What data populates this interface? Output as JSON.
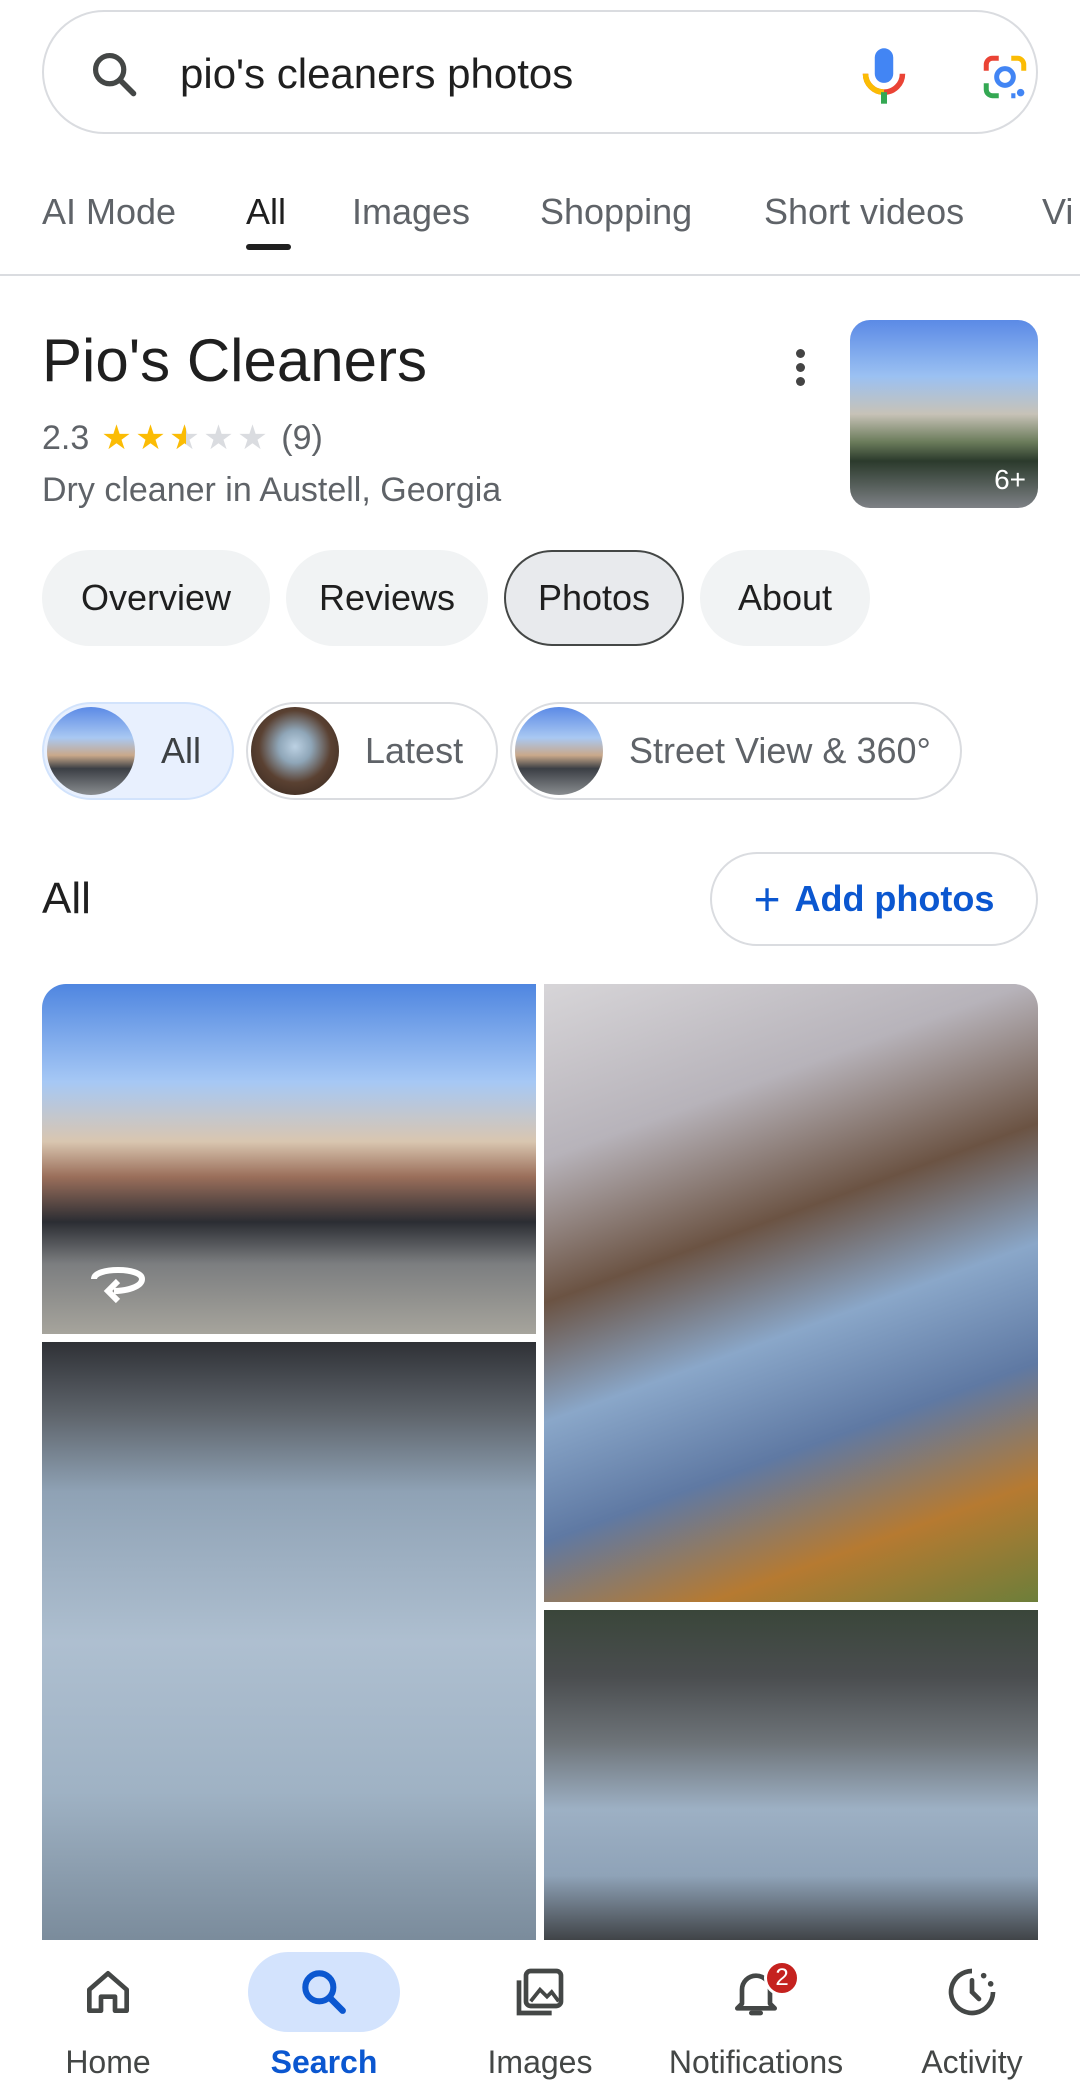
{
  "search": {
    "query": "pio's cleaners photos",
    "icons": [
      "search-icon",
      "microphone-icon",
      "google-lens-icon"
    ]
  },
  "tabs": [
    {
      "label": "AI Mode",
      "active": false
    },
    {
      "label": "All",
      "active": true
    },
    {
      "label": "Images",
      "active": false
    },
    {
      "label": "Shopping",
      "active": false
    },
    {
      "label": "Short videos",
      "active": false
    },
    {
      "label": "Vi",
      "active": false
    }
  ],
  "business": {
    "name": "Pio's Cleaners",
    "rating": "2.3",
    "rating_value": 2.3,
    "review_count": "(9)",
    "category": "Dry cleaner in Austell, Georgia",
    "photo_count": "6+"
  },
  "section_chips": [
    {
      "label": "Overview",
      "selected": false
    },
    {
      "label": "Reviews",
      "selected": false
    },
    {
      "label": "Photos",
      "selected": true
    },
    {
      "label": "About",
      "selected": false
    }
  ],
  "photo_filters": [
    {
      "label": "All",
      "selected": true
    },
    {
      "label": "Latest",
      "selected": false
    },
    {
      "label": "Street View & 360°",
      "selected": false
    }
  ],
  "all_section": {
    "title": "All",
    "add_photos_label": "Add photos"
  },
  "bottom_nav": [
    {
      "label": "Home",
      "icon": "home-icon",
      "active": false
    },
    {
      "label": "Search",
      "icon": "search-icon",
      "active": true
    },
    {
      "label": "Images",
      "icon": "images-icon",
      "active": false
    },
    {
      "label": "Notifications",
      "icon": "bell-icon",
      "active": false,
      "badge": "2"
    },
    {
      "label": "Activity",
      "icon": "activity-icon",
      "active": false
    }
  ],
  "colors": {
    "accent_blue": "#0b57d0",
    "star_yellow": "#fbbc04",
    "badge_red": "#c5221f"
  }
}
